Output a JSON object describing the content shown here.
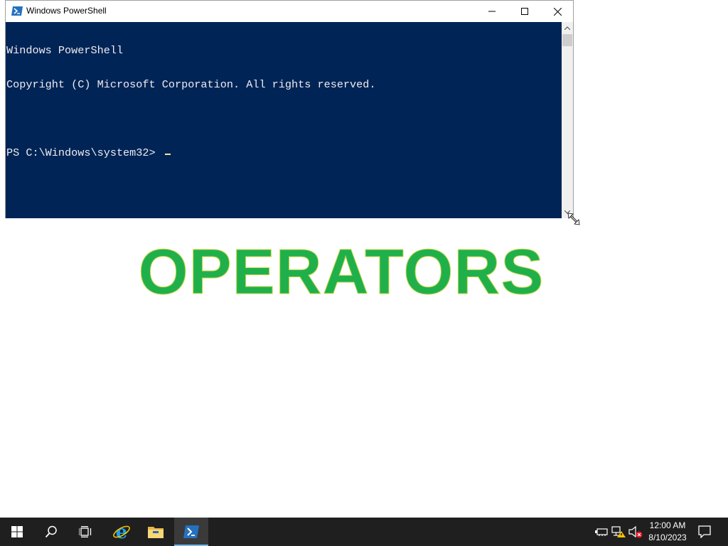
{
  "window": {
    "title": "Windows PowerShell",
    "controls": {
      "minimize": "minimize-icon",
      "maximize": "maximize-icon",
      "close": "close-icon"
    }
  },
  "console": {
    "lines": [
      "Windows PowerShell",
      "Copyright (C) Microsoft Corporation. All rights reserved.",
      "",
      "PS C:\\Windows\\system32> "
    ],
    "background": "#012456",
    "foreground": "#eeedf0",
    "cursor_color": "#f5e5a0"
  },
  "desktop": {
    "heading": "OPERATORS",
    "heading_color": "#20b04b"
  },
  "taskbar": {
    "buttons": [
      {
        "name": "start-button",
        "icon": "windows-logo-icon"
      },
      {
        "name": "search-button",
        "icon": "search-icon"
      },
      {
        "name": "task-view-button",
        "icon": "task-view-icon"
      },
      {
        "name": "internet-explorer-button",
        "icon": "internet-explorer-icon"
      },
      {
        "name": "file-explorer-button",
        "icon": "folder-icon"
      },
      {
        "name": "powershell-taskbar-button",
        "icon": "powershell-icon",
        "active": true
      }
    ],
    "tray": [
      "network-adapter-icon",
      "network-warning-icon",
      "volume-muted-icon"
    ],
    "clock": {
      "time": "12:00 AM",
      "date": "8/10/2023"
    },
    "notification_icon": "action-center-icon"
  }
}
